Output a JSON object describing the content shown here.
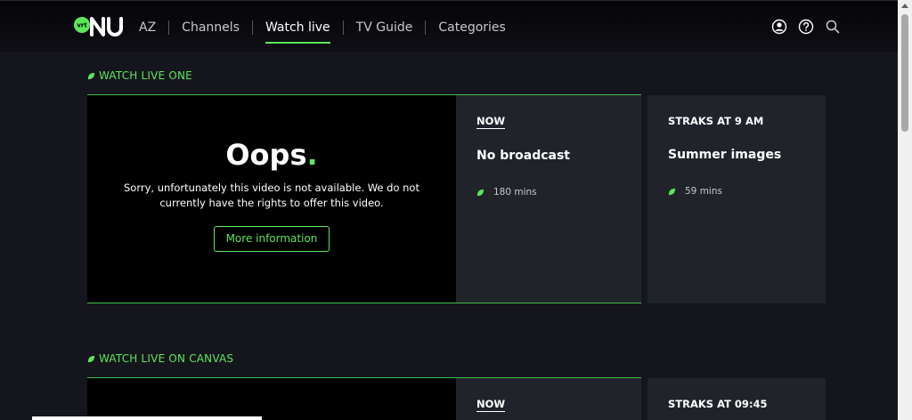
{
  "header": {
    "logo_text": "vrt NU",
    "nav": [
      {
        "label": "AZ"
      },
      {
        "label": "Channels"
      },
      {
        "label": "Watch live",
        "active": true
      },
      {
        "label": "TV Guide"
      },
      {
        "label": "Categories"
      }
    ],
    "icons": [
      "user-icon",
      "help-icon",
      "search-icon"
    ]
  },
  "sections": [
    {
      "title": "WATCH LIVE ONE",
      "player": {
        "heading": "Oops",
        "heading_dot": ".",
        "message": "Sorry, unfortunately this video is not available. We do not currently have the rights to offer this video.",
        "button": "More information"
      },
      "now": {
        "label": "NOW",
        "title": "No broadcast",
        "duration": "180 mins"
      },
      "next": {
        "label": "STRAKS AT 9 AM",
        "title": "Summer images",
        "duration": "59 mins"
      }
    },
    {
      "title": "WATCH LIVE ON CANVAS",
      "now": {
        "label": "NOW"
      },
      "next": {
        "label": "STRAKS AT 09:45"
      }
    }
  ],
  "colors": {
    "accent": "#5be65b",
    "background": "#15151d",
    "panel": "#20232a",
    "player": "#000000"
  }
}
